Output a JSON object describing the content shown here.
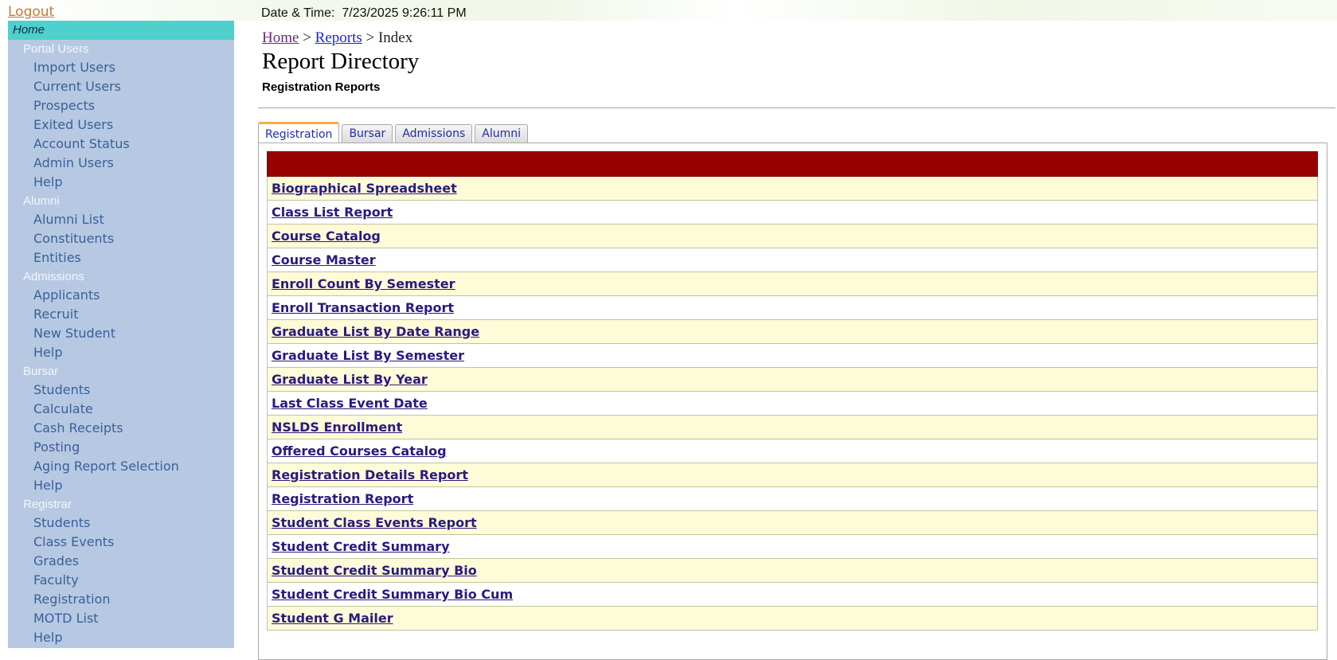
{
  "colors": {
    "sidebar_bg": "#b7c9e2",
    "home_highlight": "#4ed0cd",
    "table_header": "#990000",
    "row_alt": "#fdfbd8",
    "link": "#2a1a80",
    "active_tab_accent": "#f3b23a"
  },
  "header": {
    "logout_label": "Logout",
    "datetime_label": "Date & Time:",
    "datetime_value": "7/23/2025 9:26:11 PM"
  },
  "breadcrumb": {
    "home": "Home",
    "sep1": " > ",
    "reports": "Reports",
    "sep2": " > ",
    "current": "Index"
  },
  "page": {
    "title": "Report Directory",
    "subtitle": "Registration Reports"
  },
  "sidebar": {
    "home": "Home",
    "sections": [
      {
        "title": "Portal Users",
        "items": [
          "Import Users",
          "Current Users",
          "Prospects",
          "Exited Users",
          "Account Status",
          "Admin Users",
          "Help"
        ]
      },
      {
        "title": "Alumni",
        "items": [
          "Alumni List",
          "Constituents",
          "Entities"
        ]
      },
      {
        "title": "Admissions",
        "items": [
          "Applicants",
          "Recruit",
          "New Student",
          "Help"
        ]
      },
      {
        "title": "Bursar",
        "items": [
          "Students",
          "Calculate",
          "Cash Receipts",
          "Posting",
          "Aging Report Selection",
          "Help"
        ]
      },
      {
        "title": "Registrar",
        "items": [
          "Students",
          "Class Events",
          "Grades",
          "Faculty",
          "Registration",
          "MOTD List",
          "Help"
        ]
      }
    ]
  },
  "tabs": [
    {
      "label": "Registration",
      "active": true
    },
    {
      "label": "Bursar",
      "active": false
    },
    {
      "label": "Admissions",
      "active": false
    },
    {
      "label": "Alumni",
      "active": false
    }
  ],
  "reports": [
    "Biographical Spreadsheet",
    "Class List Report",
    "Course Catalog",
    "Course Master",
    "Enroll Count By Semester",
    "Enroll Transaction Report",
    "Graduate List By Date Range",
    "Graduate List By Semester",
    "Graduate List By Year",
    "Last Class Event Date",
    "NSLDS Enrollment",
    "Offered Courses Catalog",
    "Registration Details Report",
    "Registration Report",
    "Student Class Events Report",
    "Student Credit Summary",
    "Student Credit Summary Bio",
    "Student Credit Summary Bio Cum",
    "Student G Mailer"
  ]
}
